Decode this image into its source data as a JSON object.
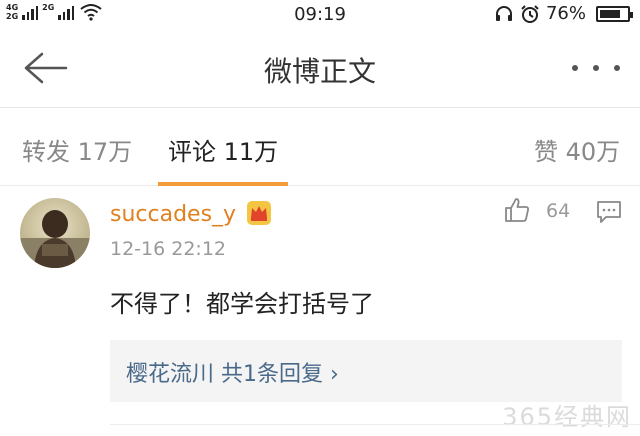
{
  "status_bar": {
    "network_top": "4G",
    "network_bottom": "2G",
    "network_second": "2G",
    "time": "09:19",
    "battery_pct": "76%",
    "battery_level": 0.76
  },
  "nav": {
    "title": "微博正文",
    "back_icon": "back-arrow-icon",
    "more_icon": "more-dots-icon"
  },
  "tabs": {
    "repost": "转发 17万",
    "comments": "评论 11万",
    "likes": "赞 40万",
    "active_color": "#f29b3a"
  },
  "comment": {
    "username": "succades_y",
    "time": "12-16 22:12",
    "like_count": "64",
    "text": "不得了！都学会打括号了",
    "replies": "樱花流川 共1条回复 ›",
    "username_color": "#e0801f"
  },
  "watermark": "365经典网"
}
